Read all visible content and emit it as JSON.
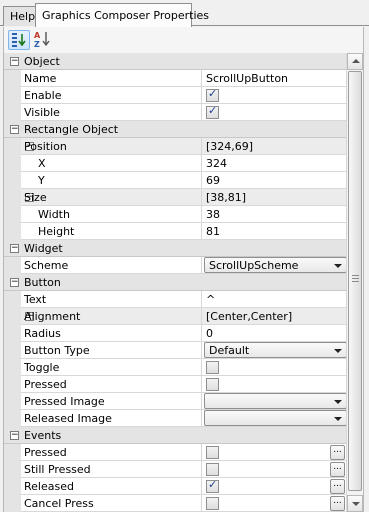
{
  "tabs": [
    {
      "label": "Help"
    },
    {
      "label": "Graphics Composer Properties"
    }
  ],
  "toolbar": {
    "categorized_icon": "categorized-icon",
    "alphabetical_icon": "alphabetical-az-icon"
  },
  "grid": {
    "categories": {
      "object": "Object",
      "rectangle": "Rectangle Object",
      "widget": "Widget",
      "button": "Button",
      "events": "Events"
    },
    "object": {
      "name_label": "Name",
      "name_value": "ScrollUpButton",
      "enable_label": "Enable",
      "enable_checked": true,
      "visible_label": "Visible",
      "visible_checked": true
    },
    "rectangle": {
      "position_label": "Position",
      "position_value": "[324,69]",
      "x_label": "X",
      "x_value": "324",
      "y_label": "Y",
      "y_value": "69",
      "size_label": "Size",
      "size_value": "[38,81]",
      "width_label": "Width",
      "width_value": "38",
      "height_label": "Height",
      "height_value": "81"
    },
    "widget": {
      "scheme_label": "Scheme",
      "scheme_value": "ScrollUpScheme"
    },
    "button": {
      "text_label": "Text",
      "text_value": "^",
      "alignment_label": "Alignment",
      "alignment_value": "[Center,Center]",
      "radius_label": "Radius",
      "radius_value": "0",
      "type_label": "Button Type",
      "type_value": "Default",
      "toggle_label": "Toggle",
      "toggle_checked": false,
      "pressed_label": "Pressed",
      "pressed_checked": false,
      "pressed_image_label": "Pressed Image",
      "pressed_image_value": "",
      "released_image_label": "Released Image",
      "released_image_value": ""
    },
    "events": {
      "pressed_label": "Pressed",
      "pressed_checked": false,
      "still_pressed_label": "Still Pressed",
      "still_pressed_checked": false,
      "released_label": "Released",
      "released_checked": true,
      "cancel_press_label": "Cancel Press",
      "cancel_press_checked": false
    },
    "ellipsis": "..."
  },
  "scrollbar": {
    "position_fraction": 0.0
  }
}
